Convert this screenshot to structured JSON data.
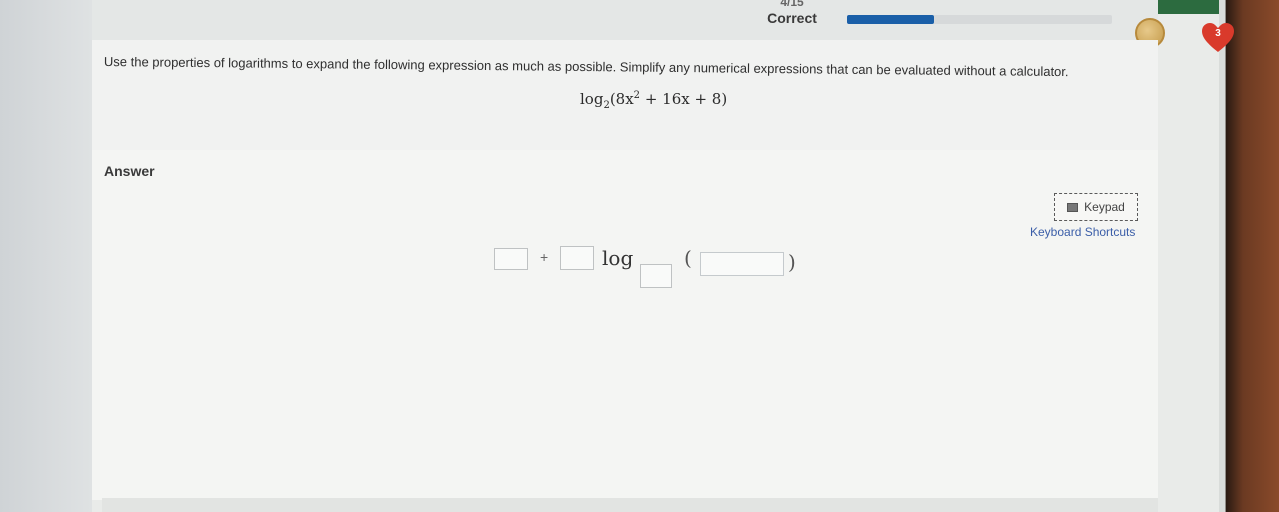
{
  "header": {
    "progress_count": "4/15",
    "progress_status": "Correct",
    "progress_fraction": 0.33,
    "hearts_count": "3"
  },
  "question": {
    "instruction": "Use the properties of logarithms to expand the following expression as much as possible. Simplify any numerical expressions that can be evaluated without a calculator.",
    "expression": {
      "log_word": "log",
      "base": "2",
      "body_open": "(8x",
      "exponent": "2",
      "body_rest": " + 16x + 8)"
    }
  },
  "answer": {
    "label": "Answer",
    "keypad_label": "Keypad",
    "shortcuts_label": "Keyboard Shortcuts",
    "plus_sign": "+",
    "log_word": "log",
    "paren_open": "(",
    "paren_close": ")"
  },
  "colors": {
    "progress_fill": "#1a5fa8",
    "heart": "#d93a2b",
    "link": "#3b5ea8",
    "top_strip": "#2c6b3f"
  },
  "icons": [
    "coin-icon",
    "heart-icon",
    "keypad-icon"
  ]
}
